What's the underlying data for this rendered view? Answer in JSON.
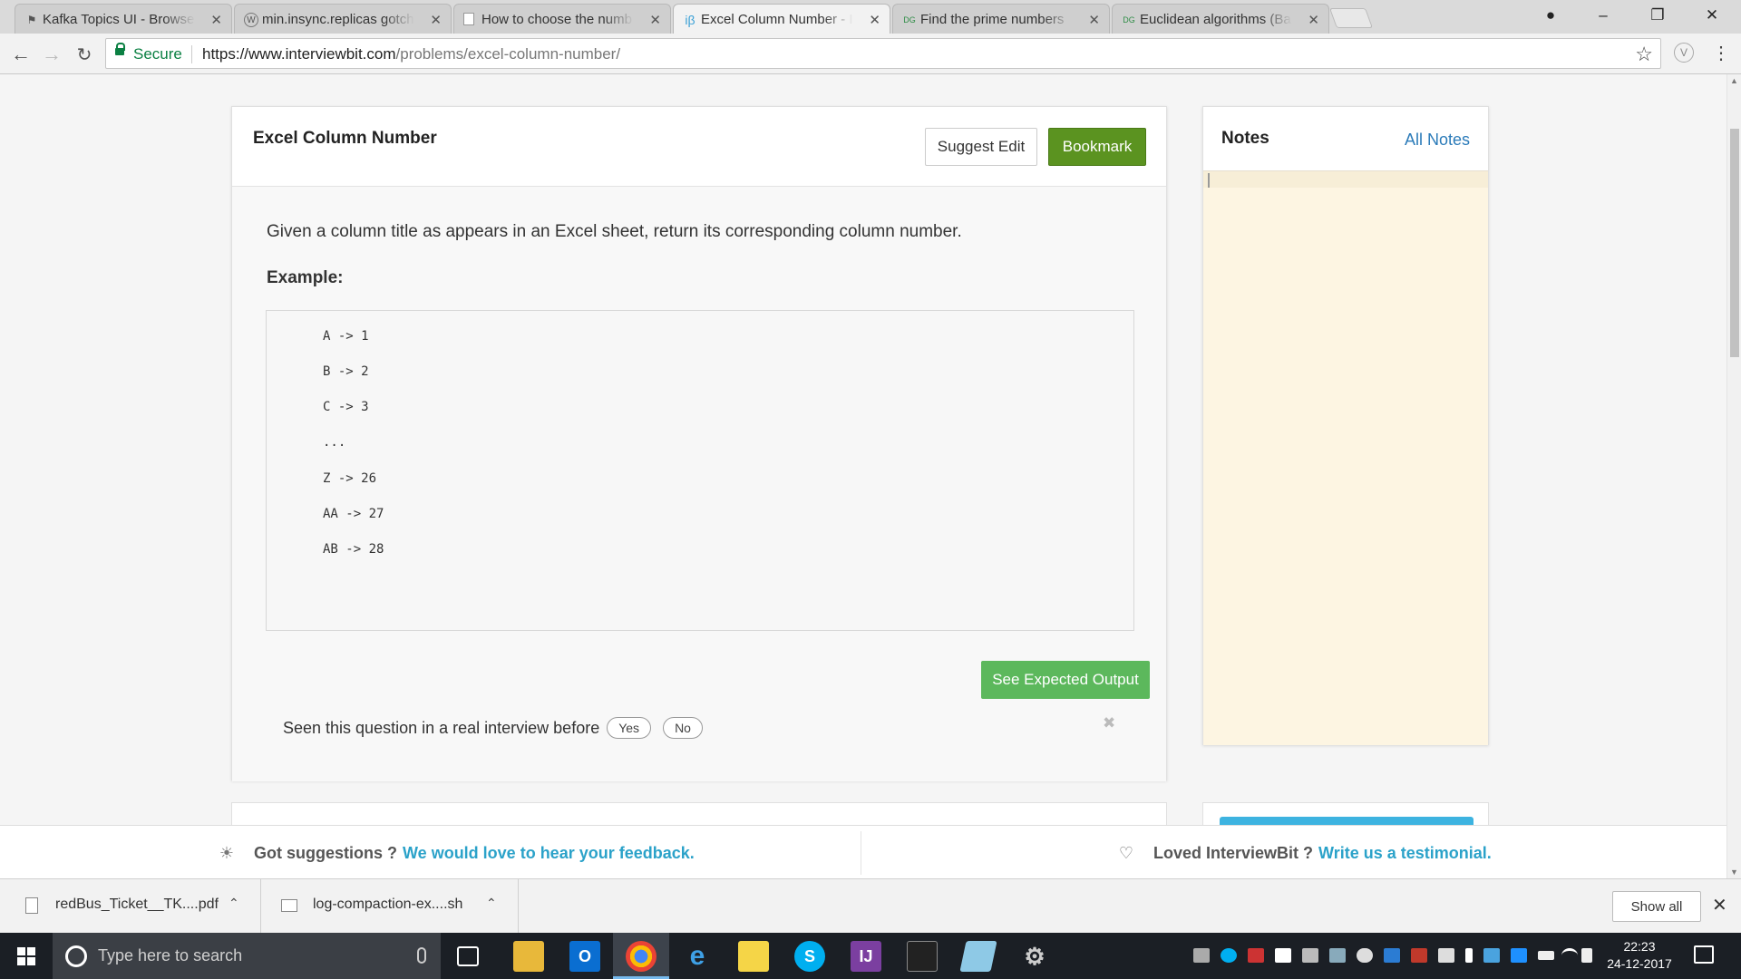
{
  "browser": {
    "tabs": [
      {
        "title": "Kafka Topics UI - Browse",
        "favicon": "kafka-icon"
      },
      {
        "title": "min.insync.replicas gotch",
        "favicon": "wordpress-icon"
      },
      {
        "title": "How to choose the numb",
        "favicon": "doc-icon"
      },
      {
        "title": "Excel Column Number - I",
        "favicon": "ib-icon",
        "favicon_text": "iβ"
      },
      {
        "title": "Find the prime numbers",
        "favicon": "gfg-icon",
        "favicon_text": "DG"
      },
      {
        "title": "Euclidean algorithms (Ba",
        "favicon": "gfg-icon",
        "favicon_text": "DG"
      }
    ],
    "secure_label": "Secure",
    "url_host": "https://www.interviewbit.com",
    "url_path": "/problems/excel-column-number/",
    "extension_label": "V"
  },
  "problem": {
    "title": "Excel Column Number",
    "suggest_edit_label": "Suggest Edit",
    "bookmark_label": "Bookmark",
    "description": "Given a column title as appears in an Excel sheet, return its corresponding column number.",
    "example_label": "Example:",
    "example_lines": [
      "A -> 1",
      "B -> 2",
      "C -> 3",
      "...",
      "Z -> 26",
      "AA -> 27",
      "AB -> 28"
    ],
    "expected_output_label": "See Expected Output",
    "seen_question": "Seen this question in a real interview before",
    "yes_label": "Yes",
    "no_label": "No"
  },
  "notes": {
    "title": "Notes",
    "all_notes_label": "All Notes"
  },
  "feedback": {
    "left_prefix": "Got suggestions ?",
    "left_link": "We would love to hear your feedback.",
    "right_prefix": "Loved InterviewBit ?",
    "right_link": "Write us a testimonial."
  },
  "downloads": {
    "items": [
      {
        "name": "redBus_Ticket__TK....pdf",
        "icon": "pdf-file-icon"
      },
      {
        "name": "log-compaction-ex....sh",
        "icon": "script-file-icon"
      }
    ],
    "show_all_label": "Show all"
  },
  "taskbar": {
    "search_placeholder": "Type here to search",
    "time": "22:23",
    "date": "24-12-2017"
  },
  "colors": {
    "bookmark_green": "#5b9320",
    "expected_green": "#5cb85c",
    "link_blue": "#2ba2c9",
    "notes_bg": "#fdf5e2"
  }
}
